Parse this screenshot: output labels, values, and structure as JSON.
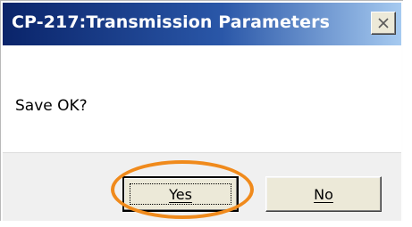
{
  "dialog": {
    "title": "CP-217:Transmission Parameters",
    "message": "Save OK?",
    "close_icon": "close-icon",
    "buttons": {
      "yes_label": "Yes",
      "no_label": "No"
    },
    "default_button": "yes",
    "annotation": {
      "type": "ellipse-highlight",
      "target": "yes-button",
      "color": "#f08a1c"
    }
  },
  "colors": {
    "titlebar_start": "#0a246a",
    "titlebar_end": "#a6caf0",
    "title_text": "#ffffff",
    "button_face": "#ece9d8",
    "button_area": "#f0f0f0",
    "highlight": "#f08a1c"
  }
}
